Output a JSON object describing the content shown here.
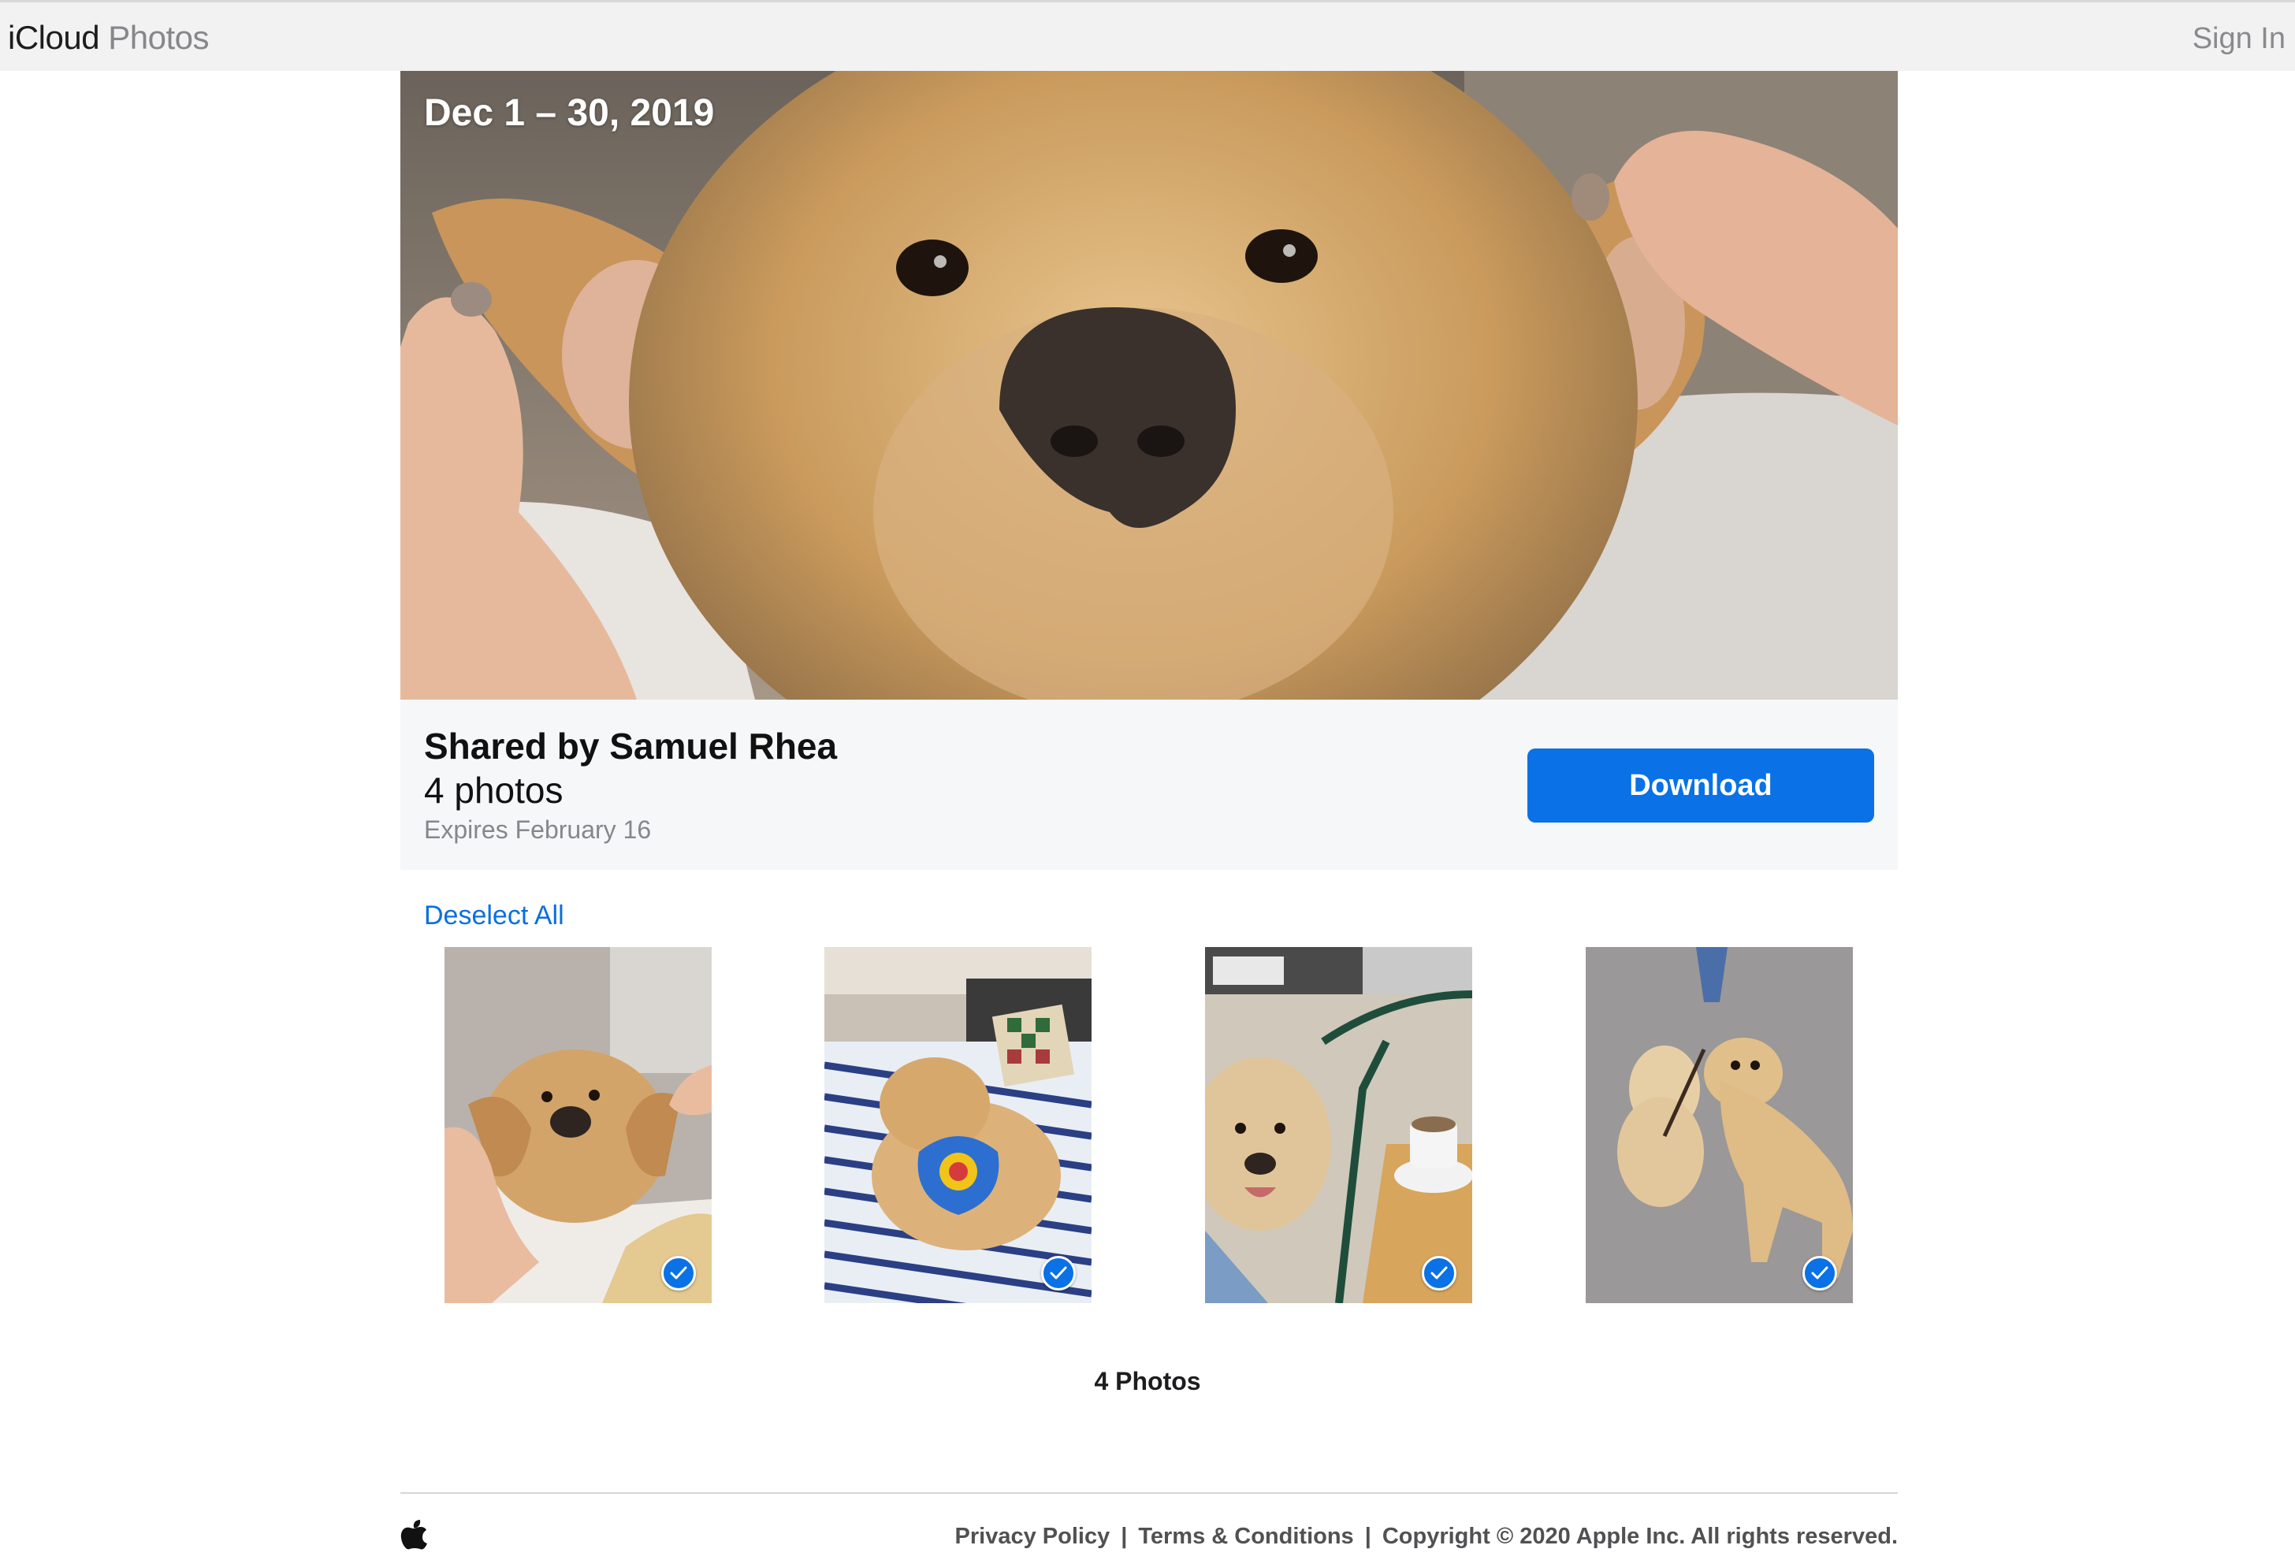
{
  "header": {
    "brand_primary": "iCloud",
    "brand_secondary": "Photos",
    "sign_in_label": "Sign In"
  },
  "hero": {
    "date_range": "Dec 1 – 30, 2019"
  },
  "share": {
    "shared_by": "Shared by Samuel Rhea",
    "photo_count": "4 photos",
    "expires": "Expires February 16",
    "download_label": "Download"
  },
  "selection": {
    "deselect_label": "Deselect All",
    "thumbnails": [
      {
        "subject": "golden retriever ears held up",
        "selected": true
      },
      {
        "subject": "dog on striped bed with bandana",
        "selected": true
      },
      {
        "subject": "dog at cafe table",
        "selected": true
      },
      {
        "subject": "two dogs on pavement",
        "selected": true
      }
    ],
    "summary": "4 Photos"
  },
  "footer": {
    "privacy_label": "Privacy Policy",
    "terms_label": "Terms & Conditions",
    "copyright": "Copyright © 2020 Apple Inc. All rights reserved.",
    "separator": "|"
  },
  "colors": {
    "accent": "#0a71e6",
    "topbar_bg": "#f2f2f2",
    "panel_bg": "#f6f7f9"
  },
  "icons": [
    "apple-logo-icon",
    "checkmark-icon"
  ]
}
